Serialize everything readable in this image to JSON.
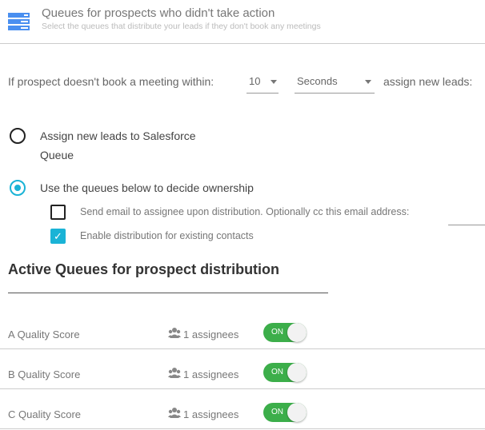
{
  "header": {
    "title": "Queues for prospects who didn't take action",
    "subtitle": "Select the queues that distribute your leads if they don't book any meetings",
    "icon": "server-stack-icon",
    "icon_color": "#4a8ff0"
  },
  "timeout": {
    "prefix": "If prospect doesn't book a meeting within:",
    "amount": "10",
    "unit": "Seconds",
    "suffix": "assign new leads:"
  },
  "options": {
    "salesforce_label_1": "Assign new leads to Salesforce",
    "salesforce_label_2": "Queue",
    "queues_label": "Use the queues below to decide ownership",
    "selected": "queues"
  },
  "checkboxes": {
    "send_email": "Send email to assignee upon distribution. Optionally cc this email address:",
    "send_email_checked": false,
    "existing": "Enable distribution for existing contacts",
    "existing_checked": true
  },
  "section_title": "Active Queues for prospect distribution",
  "queues": [
    {
      "name": "A Quality Score",
      "assignees": "1 assignees",
      "toggle": "ON"
    },
    {
      "name": "B Quality Score",
      "assignees": "1 assignees",
      "toggle": "ON"
    },
    {
      "name": "C Quality Score",
      "assignees": "1 assignees",
      "toggle": "ON"
    }
  ],
  "accent": "#1ab3d6",
  "toggle_color": "#3cae4a"
}
